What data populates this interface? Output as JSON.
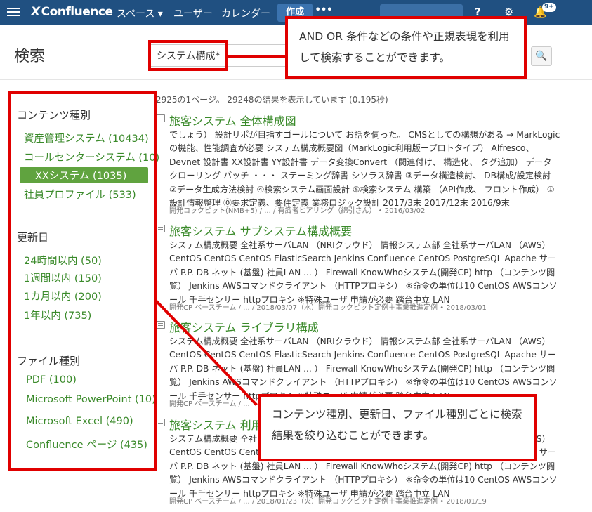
{
  "nav": {
    "logo_mark": "X",
    "logo_text": "Confluence",
    "spaces": "スペース ▾",
    "users": "ユーザー",
    "calendar": "カレンダー",
    "create": "作成",
    "more": "•••",
    "help_icon": "?",
    "settings_icon": "⚙",
    "notification_badge": "9+"
  },
  "header": {
    "title": "検索",
    "search_value": "システム構成*"
  },
  "sidebar": {
    "content_type": {
      "title": "コンテンツ種別",
      "items": [
        {
          "label": "資産管理システム (10434)"
        },
        {
          "label": "コールセンターシステム (10)"
        },
        {
          "label": "XXシステム (1035)"
        },
        {
          "label": "社員プロファイル (533)"
        }
      ]
    },
    "updated": {
      "title": "更新日",
      "items": [
        {
          "label": "24時間以内 (50)"
        },
        {
          "label": "1週間以内 (150)"
        },
        {
          "label": "1カ月以内 (200)"
        },
        {
          "label": "1年以内 (735)"
        }
      ]
    },
    "file_type": {
      "title": "ファイル種別",
      "items": [
        {
          "label": "PDF (100)"
        },
        {
          "label": "Microsoft PowerPoint (10)"
        },
        {
          "label": "Microsoft Excel (490)"
        },
        {
          "label": "Confluence ページ (435)"
        }
      ]
    }
  },
  "results": {
    "summary": "2925の1ページ。 29248の結果を表示しています (0.195秒)",
    "items": [
      {
        "title": "旅客システム 全体構成図",
        "body": "でしょう） 設計リポが目指すゴールについて お話を伺った。 CMSとしての構想がある → MarkLogicの機能、性能調査が必要 システム構成概要図（MarkLogic利用版ープロトタイプ） Alfresco、Devnet 設計書 XX設計書 YY設計書 データ変換Convert （関連付け、 構造化、 タグ追加） データ クローリング バッチ ・・・ ステーミング辞書 シソラス辞書 ③データ構造検討、 DB構成/設定検討 ②データ生成方法検討 ④検索システム画面設計 ⑤検索システム 構築 （API作成、 フロント作成） ① 設計情報整理 ⓪要求定義、要件定義 業務ロジック設計 2017/3末 2017/12末 2016/9末",
        "meta": "開発コックピット(NMB+5) / ... / 有識者ヒアリング（綿引さん） • 2016/03/02"
      },
      {
        "title": "旅客システム サブシステム構成概要",
        "body": "システム構成概要 全社系サーバLAN （NRIクラウド） 情報システム部 全社系サーバLAN （AWS） CentOS CentOS CentOS ElasticSearch Jenkins Confluence CentOS PostgreSQL Apache サーバ P.P. DB ネット (基盤) 社員LAN ... ） Firewall KnowWhoシステム(開発CP) http （コンテンツ閲覧） Jenkins AWSコマンドクライアント （HTTPプロキシ） ※命令の単位は10 CentOS AWSコンソール 千手センサー httpプロキシ ※特殊ユーザ 申請が必要 踏台中立 LAN",
        "meta": "開発CP ベースチーム / ... / 2018/03/07（水）開発コックピット定例＋事業推進定例 • 2018/03/01"
      },
      {
        "title": "旅客システム ライブラリ構成",
        "body": "システム構成概要 全社系サーバLAN （NRIクラウド） 情報システム部 全社系サーバLAN （AWS） CentOS CentOS CentOS ElasticSearch Jenkins Confluence CentOS PostgreSQL Apache サーバ P.P. DB ネット (基盤) 社員LAN ... ） Firewall KnowWhoシステム(開発CP) http （コンテンツ閲覧） Jenkins AWSコマンドクライアント （HTTPプロキシ） ※命令の単位は10 CentOS AWSコンソール 千手センサー httpプロキシ ※特殊ユーザ 申請が必要 踏台中立 LAN",
        "meta": "開発CP ベースチーム / ..."
      },
      {
        "title": "旅客システム 利用",
        "body": "システム構成概要 全社系サーバLAN （NRIクラウド） 情報システム部 全社系サーバLAN （AWS） CentOS CentOS CentOS ElasticSearch Jenkins Confluence CentOS PostgreSQL Apache サーバ P.P. DB ネット (基盤) 社員LAN ... ） Firewall KnowWhoシステム(開発CP) http （コンテンツ閲覧） Jenkins AWSコマンドクライアント （HTTPプロキシ） ※命令の単位は10 CentOS AWSコンソール 千手センサー httpプロキシ ※特殊ユーザ 申請が必要 踏台中立 LAN",
        "meta": "開発CP ベースチーム / ... / 2018/01/23（火）開発コックピット定例＋事業推進定例 • 2018/01/19"
      }
    ]
  },
  "annotations": {
    "search_callout": "AND OR 条件などの条件や正規表現を利用して検索することができます。",
    "filter_callout": "コンテンツ種別、更新日、ファイル種別ごとに検索結果を絞り込むことができます。"
  }
}
